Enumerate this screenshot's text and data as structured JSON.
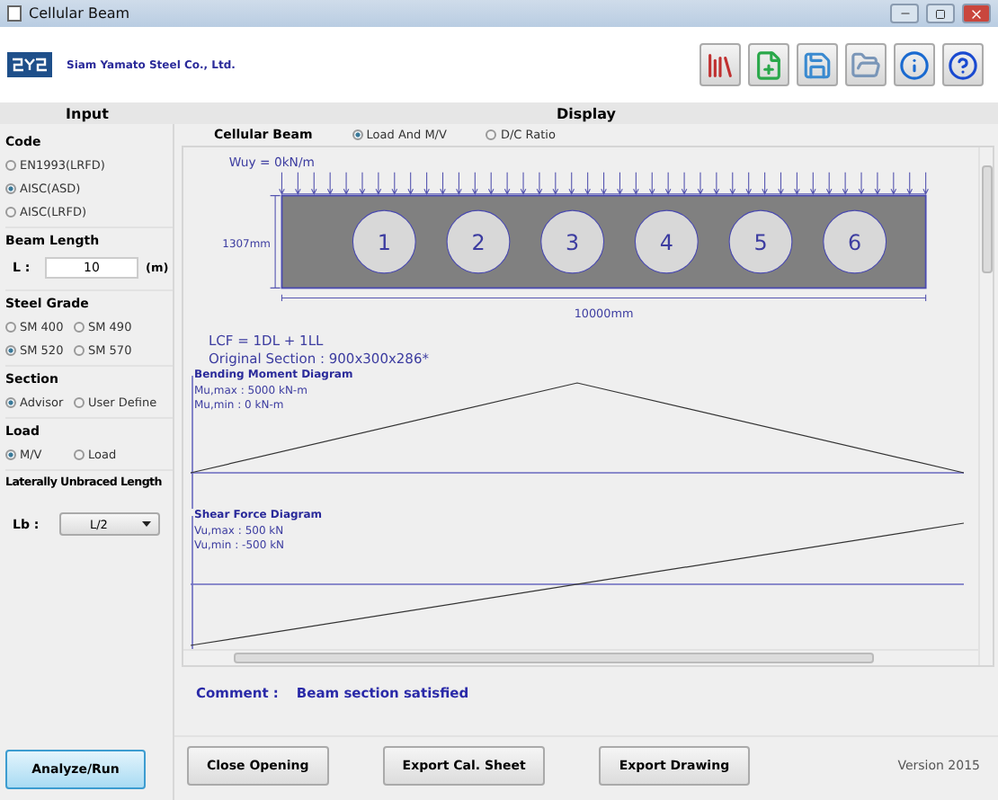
{
  "window": {
    "title": "Cellular Beam"
  },
  "company": {
    "name": "Siam Yamato Steel Co., Ltd."
  },
  "input": {
    "heading": "Input",
    "sections": [
      {
        "kind": "radio",
        "label": "Code",
        "options": [
          {
            "label": "EN1993(LRFD)",
            "selected": false
          },
          {
            "label": "AISC(ASD)",
            "selected": true
          },
          {
            "label": "AISC(LRFD)",
            "selected": false
          }
        ]
      },
      {
        "kind": "field",
        "label": "Beam Length",
        "field_label": "L :",
        "value": "10",
        "unit": "(m)"
      },
      {
        "kind": "radio",
        "label": "Steel Grade",
        "options": [
          {
            "label": "SM 400",
            "selected": false
          },
          {
            "label": "SM 490",
            "selected": false
          },
          {
            "label": "SM 520",
            "selected": true
          },
          {
            "label": "SM 570",
            "selected": false
          }
        ]
      },
      {
        "kind": "radio",
        "label": "Section",
        "options": [
          {
            "label": "Advisor",
            "selected": true
          },
          {
            "label": "User Define",
            "selected": false
          }
        ]
      },
      {
        "kind": "radio",
        "label": "Load",
        "options": [
          {
            "label": "M/V",
            "selected": true
          },
          {
            "label": "Load",
            "selected": false
          }
        ]
      },
      {
        "kind": "select",
        "label": "Laterally Unbraced Length",
        "field_label": "Lb :",
        "value": "L/2"
      }
    ]
  },
  "display": {
    "heading": "Display",
    "title": "Cellular Beam",
    "view_options": [
      {
        "label": "Load And M/V",
        "selected": true
      },
      {
        "label": "D/C Ratio",
        "selected": false
      }
    ],
    "beam": {
      "load_label": "Wuy = 0kN/m",
      "depth_label": "1307mm",
      "length_label": "10000mm",
      "openings": [
        "1",
        "2",
        "3",
        "4",
        "5",
        "6"
      ]
    },
    "load_combination": "LCF = 1DL + 1LL",
    "original_section": "Original Section :  900x300x286*",
    "diagrams": [
      {
        "kind": "moment",
        "title": "Bending Moment Diagram",
        "max": "Mu,max : 5000 kN-m",
        "min": "Mu,min : 0 kN-m"
      },
      {
        "kind": "shear",
        "title": "Shear Force Diagram",
        "max": "Vu,max : 500 kN",
        "min": "Vu,min : -500 kN"
      }
    ],
    "comment": {
      "label": "Comment :",
      "value": "Beam section satisfied"
    }
  },
  "buttons": [
    {
      "label": "Analyze/Run",
      "kind": "primary"
    },
    {
      "label": "Close Opening",
      "kind": "default"
    },
    {
      "label": "Export Cal. Sheet",
      "kind": "default"
    },
    {
      "label": "Export Drawing",
      "kind": "default"
    }
  ],
  "version": "Version 2015"
}
